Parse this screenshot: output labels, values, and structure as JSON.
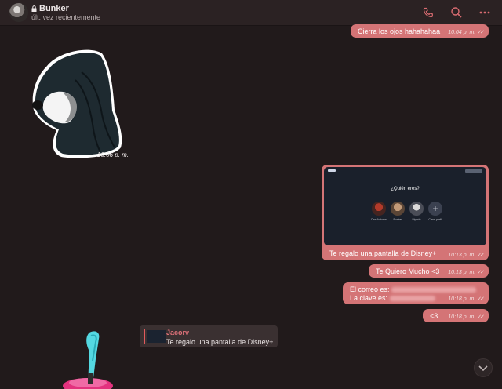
{
  "header": {
    "title": "Bunker",
    "subtitle": "últ. vez recientemente",
    "icons": [
      "lock-icon",
      "phone-icon",
      "search-icon",
      "more-icon"
    ]
  },
  "messages": {
    "m1": {
      "text": "Cierra los ojos hahahahaa",
      "time": "10:04 p. m."
    },
    "sticker": {
      "time": "10:06 p. m."
    },
    "m2": {
      "preview_title": "¿Quién eres?",
      "profiles": [
        "DarkAutumn",
        "Bunker",
        "Bipedo",
        "Crear perfil"
      ],
      "caption": "Te regalo una pantalla de Disney+",
      "time": "10:13 p. m."
    },
    "m3": {
      "text": "Te Quiero Mucho <3",
      "time": "10:13 p. m."
    },
    "m4": {
      "line1": "El correo es:",
      "line2": "La clave es:",
      "time": "10:18 p. m."
    },
    "m5": {
      "text": "<3",
      "time": "10:18 p. m."
    }
  },
  "reply": {
    "name": "Jacorv",
    "text": "Te regalo una pantalla de Disney+"
  },
  "colors": {
    "bubble": "#d47476",
    "background": "#211a1b",
    "accent": "#e05a5e"
  }
}
